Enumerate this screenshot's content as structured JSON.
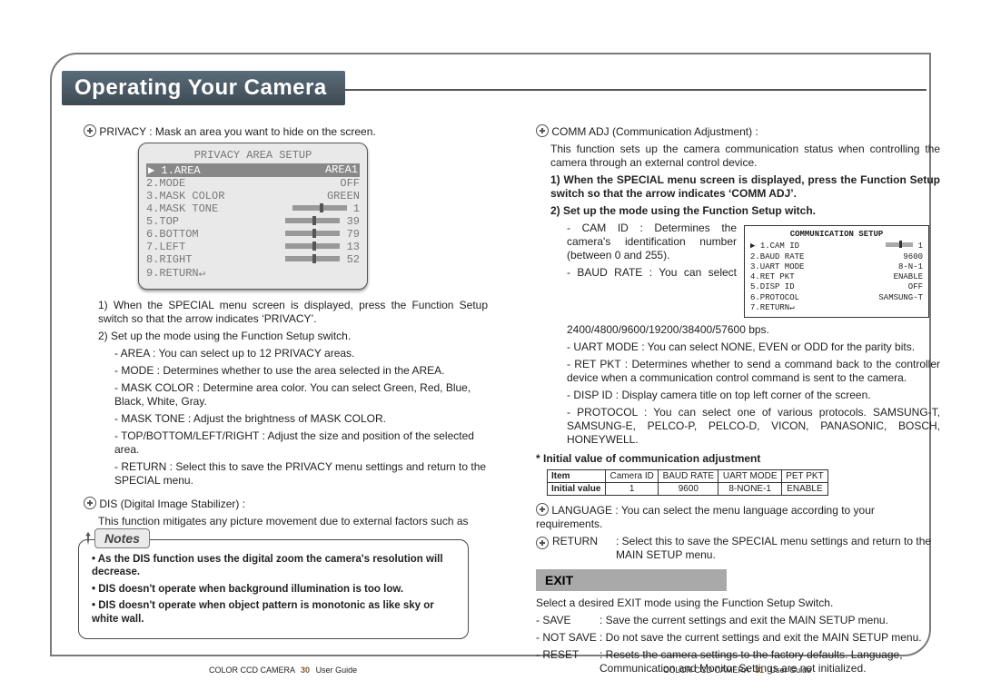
{
  "title": "Operating Your Camera",
  "left": {
    "privacy_heading": "PRIVACY : Mask an area you want to hide on the screen.",
    "osd": {
      "title": "PRIVACY AREA SETUP",
      "rows": [
        {
          "l": "▶ 1.AREA",
          "r": "AREA1",
          "hl": true
        },
        {
          "l": "2.MODE",
          "r": "OFF"
        },
        {
          "l": "3.MASK COLOR",
          "r": "GREEN"
        },
        {
          "l": "4.MASK TONE",
          "r": "1",
          "slider": true
        },
        {
          "l": "5.TOP",
          "r": "39",
          "slider": true
        },
        {
          "l": "6.BOTTOM",
          "r": "79",
          "slider": true
        },
        {
          "l": "7.LEFT",
          "r": "13",
          "slider": true
        },
        {
          "l": "8.RIGHT",
          "r": "52",
          "slider": true
        },
        {
          "l": "9.RETURN↵",
          "r": ""
        }
      ]
    },
    "p1": "1) When the SPECIAL menu screen is displayed, press the Function Setup switch so that the arrow indicates ‘PRIVACY’.",
    "p2": "2) Set up the mode using the Function Setup switch.",
    "area": "- AREA : You can select up to 12 PRIVACY areas.",
    "mode": "- MODE : Determines whether to use the area selected in the AREA.",
    "mask_color": "- MASK COLOR : Determine area color. You can select Green, Red, Blue, Black, White, Gray.",
    "mask_tone": "- MASK TONE : Adjust the brightness of MASK COLOR.",
    "tblr": "- TOP/BOTTOM/LEFT/RIGHT : Adjust the size and position of the selected area.",
    "return_l": "- RETURN : Select this to save the PRIVACY menu settings and return to the SPECIAL menu.",
    "dis_heading": "DIS (Digital Image Stabilizer) :",
    "dis_body": "This function mitigates any picture movement due to external factors such as wind.",
    "notes_title": "Notes",
    "note1": "• As the DIS function uses the digital zoom the camera's resolution will decrease.",
    "note2": "• DIS doesn't operate when background illumination is too low.",
    "note3": "• DIS doesn't operate when object pattern is monotonic as like sky or white wall."
  },
  "right": {
    "comm_heading": "COMM ADJ (Communication Adjustment) :",
    "comm_body": "This function sets up the camera communication status when controlling the camera through an external control device.",
    "step1": "1) When the SPECIAL menu screen is displayed, press the Function Setup switch so that the arrow indicates ‘COMM ADJ’.",
    "step2": "2) Set up the mode using the Function Setup witch.",
    "camid": "- CAM ID : Determines the camera's identification number (between 0 and 255).",
    "baud": "- BAUD RATE : You can select 2400/4800/9600/19200/38400/57600 bps.",
    "uart": "- UART MODE : You can select NONE, EVEN or ODD for the parity bits.",
    "retpkt": "- RET PKT : Determines whether to send a command back to the controller device when a communication control command is sent to the camera.",
    "dispid": "- DISP ID : Display camera title on top left corner of the screen.",
    "protocol": "- PROTOCOL : You can select one of various protocols. SAMSUNG-T, SAMSUNG-E, PELCO-P, PELCO-D, VICON, PANASONIC, BOSCH, HONEYWELL.",
    "init_title": "* Initial value of communication adjustment",
    "init_table": {
      "header": [
        "Item",
        "Camera ID",
        "BAUD RATE",
        "UART MODE",
        "PET PKT"
      ],
      "row": [
        "Initial value",
        "1",
        "9600",
        "8-NONE-1",
        "ENABLE"
      ]
    },
    "lang": "LANGUAGE : You can select the menu language according to your requirements.",
    "return_lbl": "RETURN",
    "return_txt": ": Select this to save the SPECIAL menu settings and return to the MAIN SETUP menu.",
    "exit_title": "EXIT",
    "exit_intro": "Select a desired EXIT mode using the Function Setup Switch.",
    "exit_save_lbl": "- SAVE",
    "exit_save": ": Save the current settings and exit the MAIN SETUP menu.",
    "exit_notsave_lbl": "- NOT SAVE",
    "exit_notsave": ": Do not save the current settings and exit the MAIN SETUP menu.",
    "exit_reset_lbl": "- RESET",
    "exit_reset": ": Resets the camera settings to the factory defaults. Language, Communication and Monitor Settings are not initialized.",
    "comm_panel": {
      "title": "COMMUNICATION SETUP",
      "rows": [
        {
          "l": "▶ 1.CAM ID",
          "r": "1",
          "slider": true
        },
        {
          "l": "2.BAUD RATE",
          "r": "9600"
        },
        {
          "l": "3.UART MODE",
          "r": "8-N-1"
        },
        {
          "l": "4.RET PKT",
          "r": "ENABLE"
        },
        {
          "l": "5.DISP ID",
          "r": "OFF"
        },
        {
          "l": "6.PROTOCOL",
          "r": "SAMSUNG-T"
        },
        {
          "l": "7.RETURN↵",
          "r": ""
        }
      ]
    }
  },
  "footer": {
    "product": "COLOR CCD CAMERA",
    "pg_left": "30",
    "pg_right": "31",
    "label": "User Guide"
  }
}
